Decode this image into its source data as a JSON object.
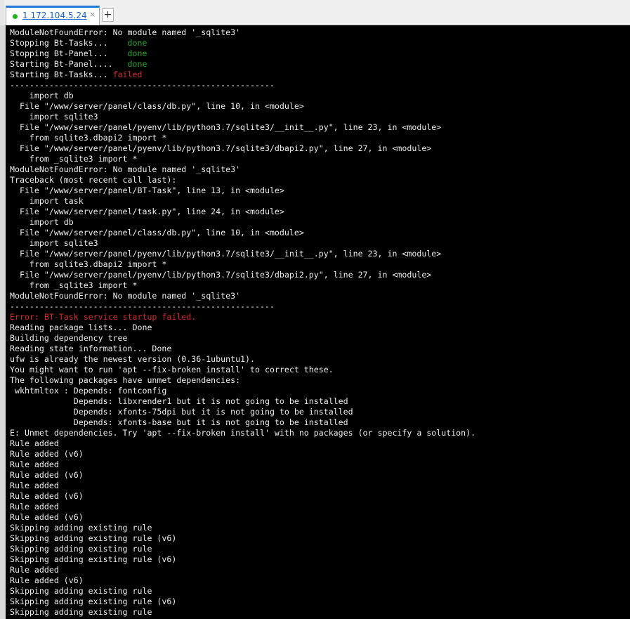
{
  "tab": {
    "label": "1 172.104.5.24",
    "close_glyph": "×",
    "add_glyph": "+",
    "status_icon": "green-dot-icon",
    "status_color": "#1db41d"
  },
  "colors": {
    "terminal_bg": "#000000",
    "text": "#ececec",
    "success": "#27a327",
    "error": "#d22c2c",
    "tab_accent": "#1e78d6"
  },
  "terminal": {
    "lines": [
      [
        {
          "t": "ModuleNotFoundError: No module named '_sqlite3'"
        }
      ],
      [
        {
          "t": "Stopping Bt-Tasks...    "
        },
        {
          "t": "done",
          "s": "ok"
        }
      ],
      [
        {
          "t": "Stopping Bt-Panel...    "
        },
        {
          "t": "done",
          "s": "ok"
        }
      ],
      [
        {
          "t": "Starting Bt-Panel....   "
        },
        {
          "t": "done",
          "s": "ok"
        }
      ],
      [
        {
          "t": "Starting Bt-Tasks... "
        },
        {
          "t": "failed",
          "s": "bad"
        }
      ],
      [
        {
          "t": "------------------------------------------------------"
        }
      ],
      [
        {
          "t": "    import db"
        }
      ],
      [
        {
          "t": "  File \"/www/server/panel/class/db.py\", line 10, in <module>"
        }
      ],
      [
        {
          "t": "    import sqlite3"
        }
      ],
      [
        {
          "t": "  File \"/www/server/panel/pyenv/lib/python3.7/sqlite3/__init__.py\", line 23, in <module>"
        }
      ],
      [
        {
          "t": "    from sqlite3.dbapi2 import *"
        }
      ],
      [
        {
          "t": "  File \"/www/server/panel/pyenv/lib/python3.7/sqlite3/dbapi2.py\", line 27, in <module>"
        }
      ],
      [
        {
          "t": "    from _sqlite3 import *"
        }
      ],
      [
        {
          "t": "ModuleNotFoundError: No module named '_sqlite3'"
        }
      ],
      [
        {
          "t": "Traceback (most recent call last):"
        }
      ],
      [
        {
          "t": "  File \"/www/server/panel/BT-Task\", line 13, in <module>"
        }
      ],
      [
        {
          "t": "    import task"
        }
      ],
      [
        {
          "t": "  File \"/www/server/panel/task.py\", line 24, in <module>"
        }
      ],
      [
        {
          "t": "    import db"
        }
      ],
      [
        {
          "t": "  File \"/www/server/panel/class/db.py\", line 10, in <module>"
        }
      ],
      [
        {
          "t": "    import sqlite3"
        }
      ],
      [
        {
          "t": "  File \"/www/server/panel/pyenv/lib/python3.7/sqlite3/__init__.py\", line 23, in <module>"
        }
      ],
      [
        {
          "t": "    from sqlite3.dbapi2 import *"
        }
      ],
      [
        {
          "t": "  File \"/www/server/panel/pyenv/lib/python3.7/sqlite3/dbapi2.py\", line 27, in <module>"
        }
      ],
      [
        {
          "t": "    from _sqlite3 import *"
        }
      ],
      [
        {
          "t": "ModuleNotFoundError: No module named '_sqlite3'"
        }
      ],
      [
        {
          "t": "------------------------------------------------------"
        }
      ],
      [
        {
          "t": "Error: BT-Task service startup failed.",
          "s": "bad"
        }
      ],
      [
        {
          "t": "Reading package lists... Done"
        }
      ],
      [
        {
          "t": "Building dependency tree"
        }
      ],
      [
        {
          "t": "Reading state information... Done"
        }
      ],
      [
        {
          "t": "ufw is already the newest version (0.36-1ubuntu1)."
        }
      ],
      [
        {
          "t": "You might want to run 'apt --fix-broken install' to correct these."
        }
      ],
      [
        {
          "t": "The following packages have unmet dependencies:"
        }
      ],
      [
        {
          "t": " wkhtmltox : Depends: fontconfig"
        }
      ],
      [
        {
          "t": "             Depends: libxrender1 but it is not going to be installed"
        }
      ],
      [
        {
          "t": "             Depends: xfonts-75dpi but it is not going to be installed"
        }
      ],
      [
        {
          "t": "             Depends: xfonts-base but it is not going to be installed"
        }
      ],
      [
        {
          "t": "E: Unmet dependencies. Try 'apt --fix-broken install' with no packages (or specify a solution)."
        }
      ],
      [
        {
          "t": "Rule added"
        }
      ],
      [
        {
          "t": "Rule added (v6)"
        }
      ],
      [
        {
          "t": "Rule added"
        }
      ],
      [
        {
          "t": "Rule added (v6)"
        }
      ],
      [
        {
          "t": "Rule added"
        }
      ],
      [
        {
          "t": "Rule added (v6)"
        }
      ],
      [
        {
          "t": "Rule added"
        }
      ],
      [
        {
          "t": "Rule added (v6)"
        }
      ],
      [
        {
          "t": "Skipping adding existing rule"
        }
      ],
      [
        {
          "t": "Skipping adding existing rule (v6)"
        }
      ],
      [
        {
          "t": "Skipping adding existing rule"
        }
      ],
      [
        {
          "t": "Skipping adding existing rule (v6)"
        }
      ],
      [
        {
          "t": "Rule added"
        }
      ],
      [
        {
          "t": "Rule added (v6)"
        }
      ],
      [
        {
          "t": "Skipping adding existing rule"
        }
      ],
      [
        {
          "t": "Skipping adding existing rule (v6)"
        }
      ],
      [
        {
          "t": "Skipping adding existing rule"
        }
      ]
    ]
  }
}
